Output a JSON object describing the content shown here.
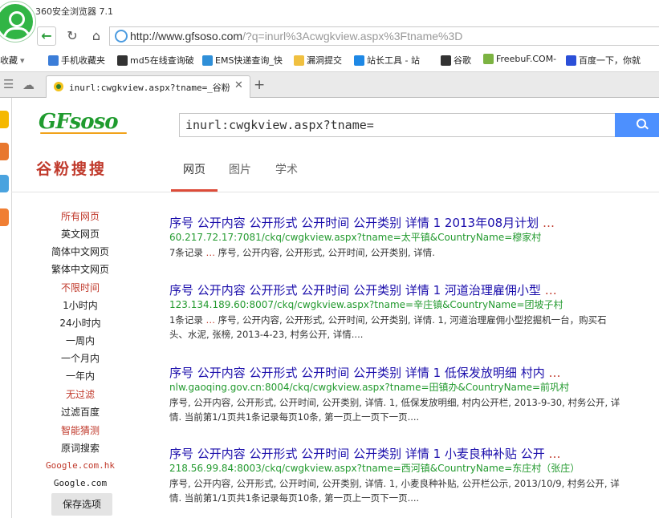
{
  "browser": {
    "app_title": "360安全浏览器 7.1",
    "address": {
      "host": "http://www.gfsoso.com",
      "path": "/?q=inurl%3Acwgkview.aspx%3Ftname%3D"
    },
    "bookmarks": [
      {
        "label": "收藏",
        "icon": "star-icon",
        "color": "#f2b400"
      },
      {
        "label": "手机收藏夹",
        "icon": "phone-icon",
        "color": "#3b7dd8"
      },
      {
        "label": "md5在线查询破",
        "icon": "grid-icon",
        "color": "#333333"
      },
      {
        "label": "EMS快递查询_快",
        "icon": "ems-icon",
        "color": "#2f8fd8"
      },
      {
        "label": "漏洞提交",
        "icon": "folder-icon",
        "color": "#f0c040"
      },
      {
        "label": "站长工具 - 站",
        "icon": "chinaz-icon",
        "color": "#1e88e5"
      },
      {
        "label": "谷歌",
        "icon": "g-icon",
        "color": "#333333"
      },
      {
        "label": "FreebuF.COM-",
        "icon": "freebuf-icon",
        "color": "#7cb342"
      },
      {
        "label": "百度一下，你就",
        "icon": "baidu-icon",
        "color": "#2b4fd8"
      }
    ],
    "tab": {
      "title": "inurl:cwgkview.aspx?tname=_谷粉搜",
      "close": "✕"
    },
    "new_tab": "+"
  },
  "page": {
    "logo": "GFsoso",
    "search_query": "inurl:cwgkview.aspx?tname=",
    "brand_cn": "谷粉搜搜",
    "tabs": [
      {
        "label": "网页",
        "active": true
      },
      {
        "label": "图片",
        "active": false
      },
      {
        "label": "学术",
        "active": false
      }
    ],
    "filters": [
      {
        "label": "所有网页",
        "style": "red"
      },
      {
        "label": "英文网页",
        "style": "normal"
      },
      {
        "label": "简体中文网页",
        "style": "normal"
      },
      {
        "label": "繁体中文网页",
        "style": "normal"
      },
      {
        "label": "不限时间",
        "style": "red"
      },
      {
        "label": "1小时内",
        "style": "normal"
      },
      {
        "label": "24小时内",
        "style": "normal"
      },
      {
        "label": "一周内",
        "style": "normal"
      },
      {
        "label": "一个月内",
        "style": "normal"
      },
      {
        "label": "一年内",
        "style": "normal"
      },
      {
        "label": "无过滤",
        "style": "red"
      },
      {
        "label": "过滤百度",
        "style": "normal"
      },
      {
        "label": "智能猜测",
        "style": "red"
      },
      {
        "label": "原词搜索",
        "style": "normal"
      },
      {
        "label": "Google.com.hk",
        "style": "red mono"
      },
      {
        "label": "Google.com",
        "style": "mono"
      }
    ],
    "save_button": "保存选项",
    "results": [
      {
        "title": "序号  公开内容  公开形式  公开时间  公开类别  详情  1 2013年08月计划",
        "url": "60.217.72.17:7081/ckq/cwgkview.aspx?tname=太平镇&CountryName=穆家村",
        "snippet": "7条记录 … 序号, 公开内容, 公开形式, 公开时间, 公开类别, 详情."
      },
      {
        "title": "序号  公开内容  公开形式  公开时间  公开类别  详情  1 河道治理雇佣小型",
        "url": "123.134.189.60:8007/ckq/cwgkview.aspx?tname=辛庄镇&CountryName=团坡子村",
        "snippet": "1条记录 … 序号, 公开内容, 公开形式, 公开时间, 公开类别, 详情. 1, 河道治理雇佣小型挖掘机一台，购买石头、水泥, 张榜, 2013-4-23, 村务公开, 详情...."
      },
      {
        "title": "序号  公开内容  公开形式  公开时间  公开类别  详情  1 低保发放明细  村内",
        "url": "nlw.gaoqing.gov.cn:8004/ckq/cwgkview.aspx?tname=田镇办&CountryName=前巩村",
        "snippet": "序号, 公开内容, 公开形式, 公开时间, 公开类别, 详情. 1, 低保发放明细, 村内公开栏, 2013-9-30, 村务公开, 详情. 当前第1/1页共1条记录每页10条, 第一页上一页下一页...."
      },
      {
        "title": "序号  公开内容  公开形式  公开时间  公开类别  详情  1 小麦良种补贴  公开",
        "url": "218.56.99.84:8003/ckq/cwgkview.aspx?tname=西河镇&CountryName=东庄村（张庄）",
        "snippet": "序号, 公开内容, 公开形式, 公开时间, 公开类别, 详情. 1, 小麦良种补贴, 公开栏公示, 2013/10/9, 村务公开, 详情. 当前第1/1页共1条记录每页10条, 第一页上一页下一页...."
      }
    ],
    "ellipsis": "…"
  }
}
